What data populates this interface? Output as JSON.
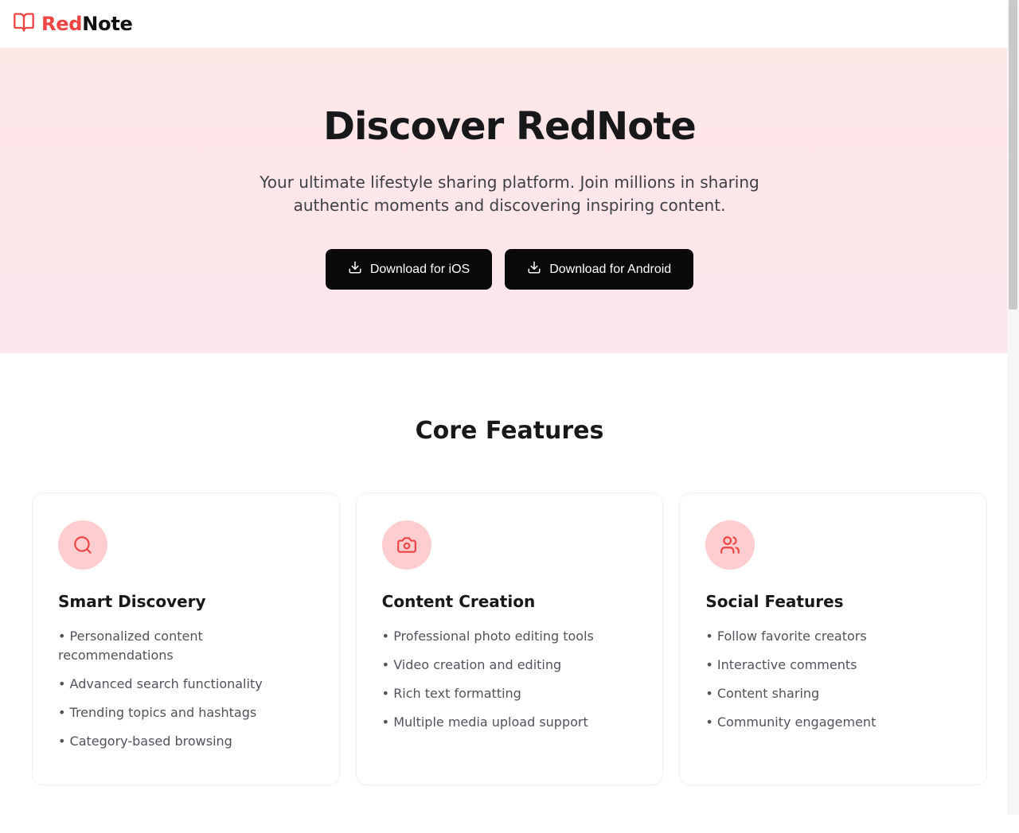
{
  "brand": {
    "part1": "Red",
    "part2": "Note"
  },
  "hero": {
    "title": "Discover RedNote",
    "subtitle": "Your ultimate lifestyle sharing platform. Join millions in sharing authentic moments and discovering inspiring content.",
    "cta_ios": "Download for iOS",
    "cta_android": "Download for Android"
  },
  "features": {
    "heading": "Core Features",
    "cards": [
      {
        "title": "Smart Discovery",
        "items": [
          "Personalized content recommendations",
          "Advanced search functionality",
          "Trending topics and hashtags",
          "Category-based browsing"
        ]
      },
      {
        "title": "Content Creation",
        "items": [
          "Professional photo editing tools",
          "Video creation and editing",
          "Rich text formatting",
          "Multiple media upload support"
        ]
      },
      {
        "title": "Social Features",
        "items": [
          "Follow favorite creators",
          "Interactive comments",
          "Content sharing",
          "Community engagement"
        ]
      }
    ]
  }
}
